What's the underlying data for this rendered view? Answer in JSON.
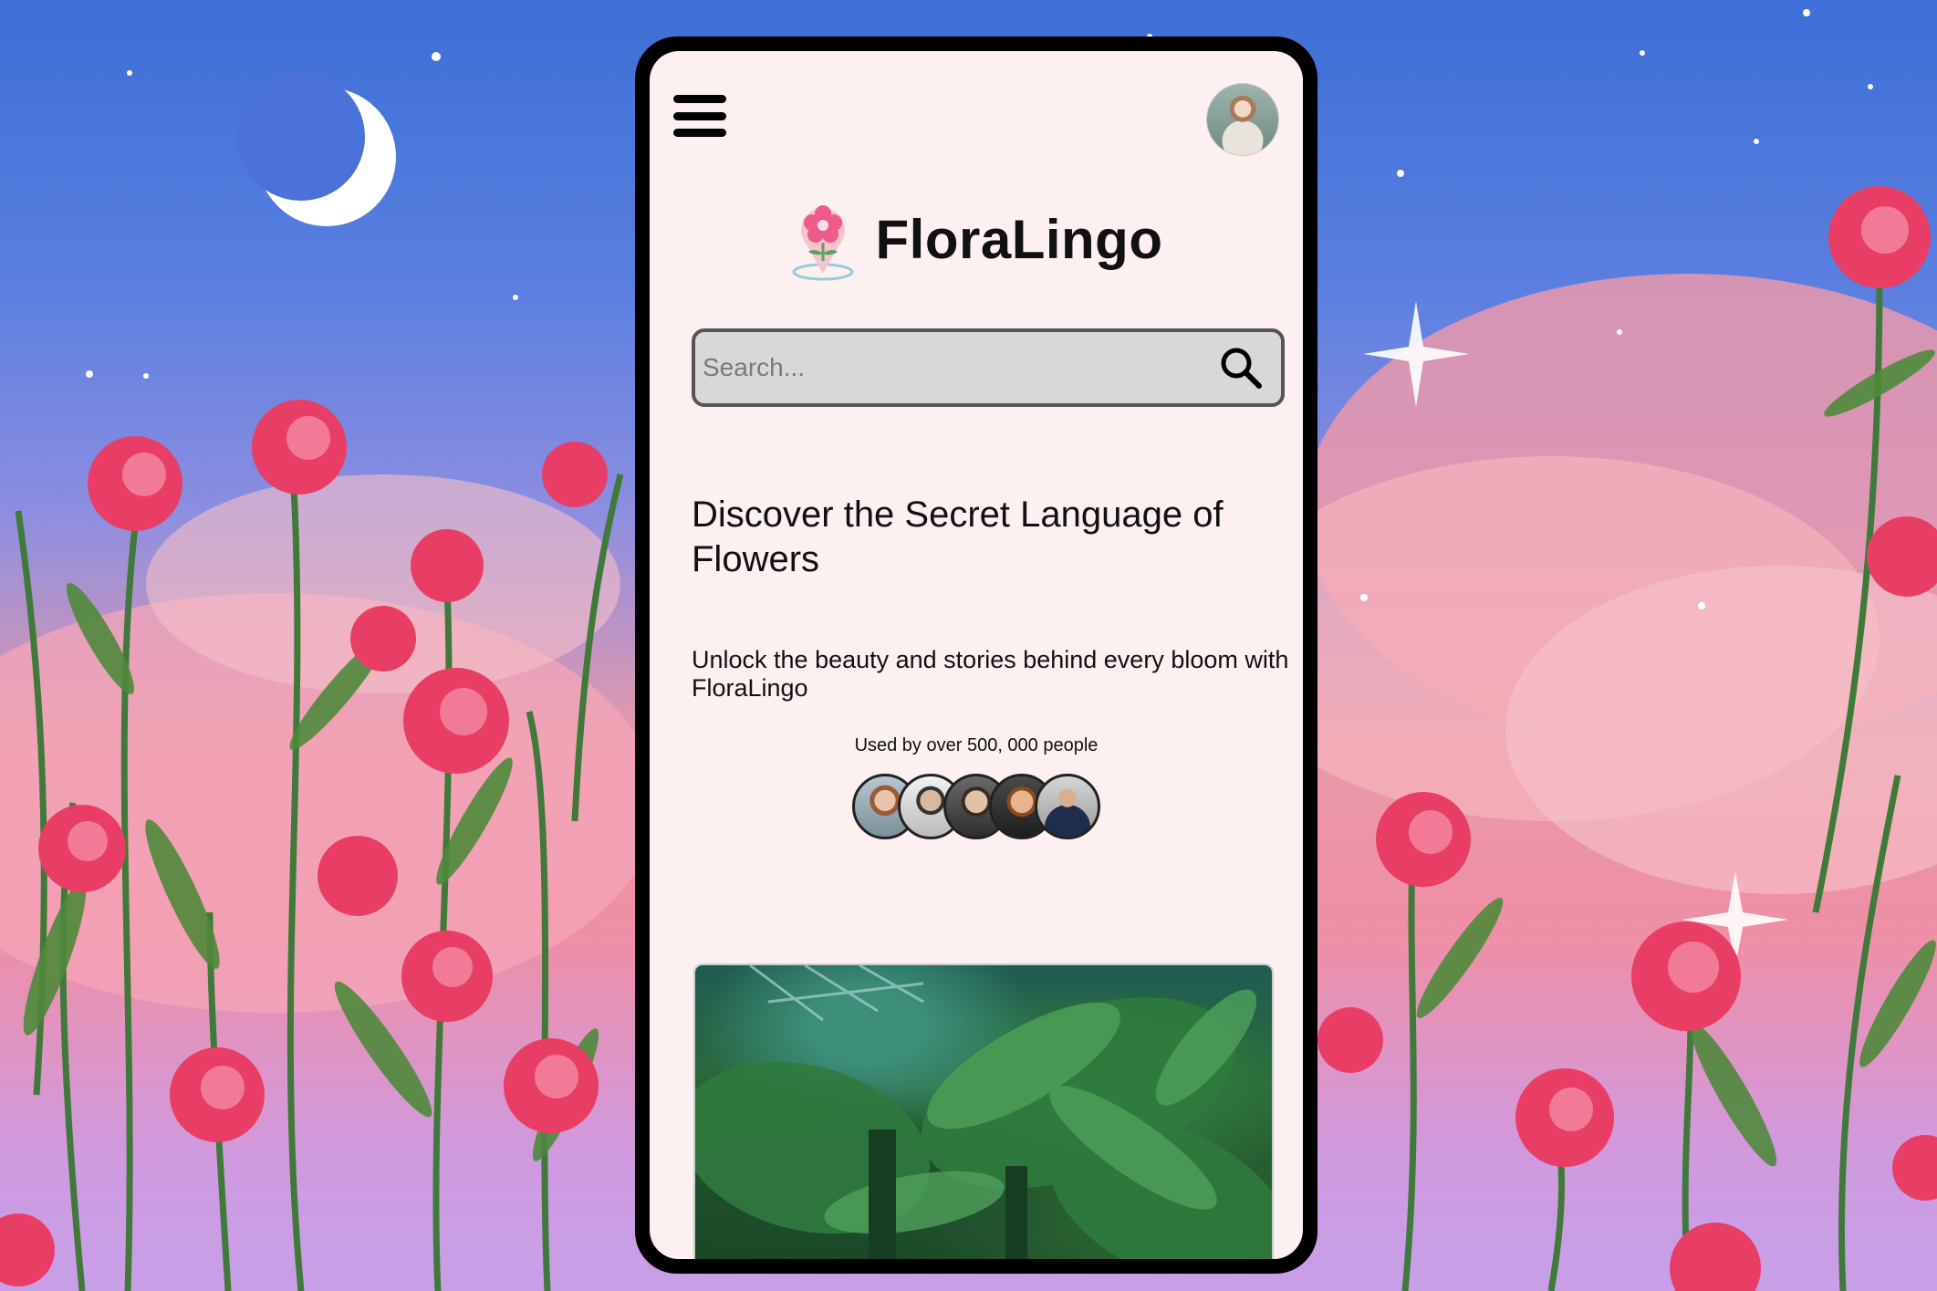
{
  "app": {
    "title": "FloraLingo"
  },
  "header": {
    "menu_icon": "hamburger-menu-icon",
    "profile_avatar": "user-avatar"
  },
  "search": {
    "placeholder": "Search...",
    "icon": "search-icon"
  },
  "hero": {
    "title": "Discover the Secret Language of Flowers",
    "subtitle": "Unlock the beauty and stories behind every bloom with FloraLingo",
    "social_proof": "Used by over 500, 000 people",
    "avatars": [
      "user-1",
      "user-2",
      "user-3",
      "user-4",
      "user-5"
    ]
  },
  "feature_image": {
    "name": "greenhouse-photo"
  },
  "colors": {
    "screen_bg": "#fdf0f0",
    "search_bg": "#d8d8d8",
    "accent": "#ef5a8a"
  }
}
